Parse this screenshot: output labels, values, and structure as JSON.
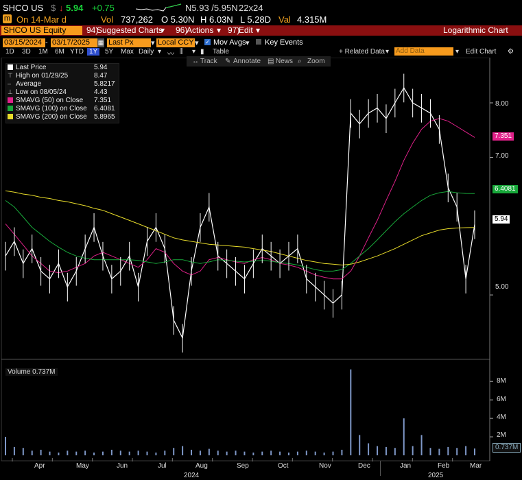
{
  "header": {
    "ticker": "SHCO US",
    "currency": "$",
    "arrow": "↓",
    "last": "5.94",
    "change": "+0.75",
    "bid_ask": "N5.93 /5.95N",
    "size": "22x24",
    "on_label": "On 14-Mar d",
    "vol_label": "Vol",
    "volume": "737,262",
    "open": "O 5.30N",
    "high": "H 6.03N",
    "low": "L 5.28D",
    "val_label": "Val",
    "value": "4.315M"
  },
  "menubar": {
    "security": "SHCO US Equity",
    "suggested": "Suggested Charts",
    "suggested_num": "94)",
    "actions": "Actions",
    "actions_num": "96)",
    "edit": "Edit",
    "edit_num": "97)",
    "chart_type": "Logarithmic Chart"
  },
  "params": {
    "start_date": "03/15/2024",
    "end_date": "03/17/2025",
    "field": "Last Px",
    "currency": "Local CCY",
    "mov_avgs": "Mov Avgs",
    "key_events": "Key Events"
  },
  "periods": [
    "1D",
    "3D",
    "1M",
    "6M",
    "YTD",
    "1Y",
    "5Y",
    "Max"
  ],
  "selected_period": "1Y",
  "frequency": "Daily",
  "table_label": "Table",
  "related_data": "+ Related Data",
  "add_data": "Add Data",
  "edit_chart": "Edit Chart",
  "tools": [
    "Track",
    "Annotate",
    "News",
    "Zoom"
  ],
  "legend": [
    {
      "label": "Last Price",
      "value": "5.94",
      "color": "#ffffff"
    },
    {
      "label": "High on 01/29/25",
      "value": "8.47",
      "color": "#cccccc"
    },
    {
      "label": "Average",
      "value": "5.8217",
      "color": "#cccccc"
    },
    {
      "label": "Low on 08/05/24",
      "value": "4.43",
      "color": "#cccccc"
    },
    {
      "label": "SMAVG (50)  on Close",
      "value": "7.351",
      "color": "#e0218a"
    },
    {
      "label": "SMAVG (100)  on Close",
      "value": "6.4081",
      "color": "#18a83a"
    },
    {
      "label": "SMAVG (200)  on Close",
      "value": "5.8965",
      "color": "#e8dc2a"
    }
  ],
  "volume_legend": "Volume 0.737M",
  "tags": {
    "sma50": "7.351",
    "sma100": "6.4081",
    "last": "5.94",
    "volume": "0.737M"
  },
  "chart_data": {
    "type": "line",
    "scale": "log",
    "x": [
      "Apr",
      "May",
      "Jun",
      "Jul",
      "Aug",
      "Sep",
      "Oct",
      "Nov",
      "Dec",
      "Jan",
      "Feb",
      "Mar"
    ],
    "year_labels": [
      "2024",
      "2025"
    ],
    "y_ticks": [
      "8.00",
      "7.00",
      "5.00"
    ],
    "ylim": [
      4.3,
      8.7
    ],
    "volume_ticks": [
      "8M",
      "6M",
      "4M",
      "2M"
    ],
    "volume_ylim": [
      0,
      9.5
    ],
    "series": [
      {
        "name": "Last Price",
        "color": "#ffffff",
        "values": [
          5.5,
          5.7,
          5.4,
          5.6,
          5.3,
          5.2,
          5.4,
          5.1,
          5.3,
          5.6,
          5.9,
          5.5,
          5.2,
          5.3,
          5.5,
          5.1,
          5.7,
          5.9,
          5.6,
          4.7,
          4.5,
          5.3,
          5.9,
          6.2,
          5.5,
          5.4,
          5.3,
          5.2,
          5.4,
          5.6,
          5.5,
          5.4,
          5.5,
          5.6,
          5.2,
          5.1,
          5.0,
          4.9,
          5.0,
          7.8,
          7.6,
          7.8,
          7.9,
          7.7,
          8.0,
          8.3,
          8.0,
          7.9,
          7.8,
          7.5,
          6.5,
          6.2,
          5.2,
          5.94
        ]
      },
      {
        "name": "SMAVG (50)  on Close",
        "color": "#e0218a",
        "values": [
          5.95,
          5.8,
          5.65,
          5.5,
          5.4,
          5.3,
          5.28,
          5.3,
          5.35,
          5.4,
          5.5,
          5.55,
          5.5,
          5.45,
          5.4,
          5.35,
          5.45,
          5.6,
          5.55,
          5.4,
          5.3,
          5.25,
          5.3,
          5.45,
          5.48,
          5.45,
          5.42,
          5.4,
          5.45,
          5.48,
          5.45,
          5.4,
          5.38,
          5.35,
          5.3,
          5.25,
          5.22,
          5.2,
          5.2,
          5.3,
          5.5,
          5.75,
          6.0,
          6.3,
          6.6,
          6.95,
          7.25,
          7.5,
          7.65,
          7.7,
          7.65,
          7.55,
          7.45,
          7.351
        ]
      },
      {
        "name": "SMAVG (100)  on Close",
        "color": "#18a83a",
        "values": [
          6.3,
          6.2,
          6.05,
          5.9,
          5.8,
          5.7,
          5.62,
          5.55,
          5.5,
          5.47,
          5.45,
          5.45,
          5.45,
          5.45,
          5.45,
          5.44,
          5.42,
          5.4,
          5.42,
          5.45,
          5.45,
          5.42,
          5.4,
          5.42,
          5.45,
          5.44,
          5.43,
          5.42,
          5.43,
          5.44,
          5.43,
          5.41,
          5.4,
          5.38,
          5.35,
          5.32,
          5.3,
          5.3,
          5.32,
          5.4,
          5.5,
          5.6,
          5.72,
          5.85,
          5.98,
          6.1,
          6.2,
          6.3,
          6.38,
          6.42,
          6.44,
          6.42,
          6.41,
          6.4081
        ]
      },
      {
        "name": "SMAVG (200)  on Close",
        "color": "#e8dc2a",
        "values": [
          6.45,
          6.43,
          6.4,
          6.38,
          6.35,
          6.33,
          6.3,
          6.28,
          6.25,
          6.22,
          6.18,
          6.15,
          6.1,
          6.05,
          6.0,
          5.95,
          5.9,
          5.85,
          5.8,
          5.75,
          5.72,
          5.7,
          5.68,
          5.66,
          5.65,
          5.64,
          5.63,
          5.62,
          5.6,
          5.58,
          5.56,
          5.53,
          5.5,
          5.47,
          5.44,
          5.42,
          5.4,
          5.39,
          5.38,
          5.39,
          5.42,
          5.46,
          5.5,
          5.55,
          5.6,
          5.66,
          5.72,
          5.78,
          5.82,
          5.86,
          5.88,
          5.89,
          5.895,
          5.8965
        ]
      }
    ],
    "volume": [
      2.0,
      0.9,
      0.8,
      0.5,
      0.6,
      0.4,
      0.3,
      0.5,
      0.4,
      0.5,
      0.3,
      0.4,
      0.6,
      0.5,
      0.4,
      0.5,
      0.4,
      0.3,
      0.5,
      0.8,
      1.0,
      0.6,
      0.5,
      0.7,
      0.5,
      0.4,
      0.5,
      0.4,
      0.3,
      0.4,
      0.5,
      0.4,
      0.3,
      0.4,
      0.5,
      0.4,
      0.3,
      0.4,
      0.6,
      9.3,
      2.2,
      1.3,
      1.0,
      0.9,
      0.8,
      4.0,
      1.0,
      2.2,
      0.8,
      0.7,
      0.9,
      0.8,
      1.0,
      0.737
    ]
  }
}
